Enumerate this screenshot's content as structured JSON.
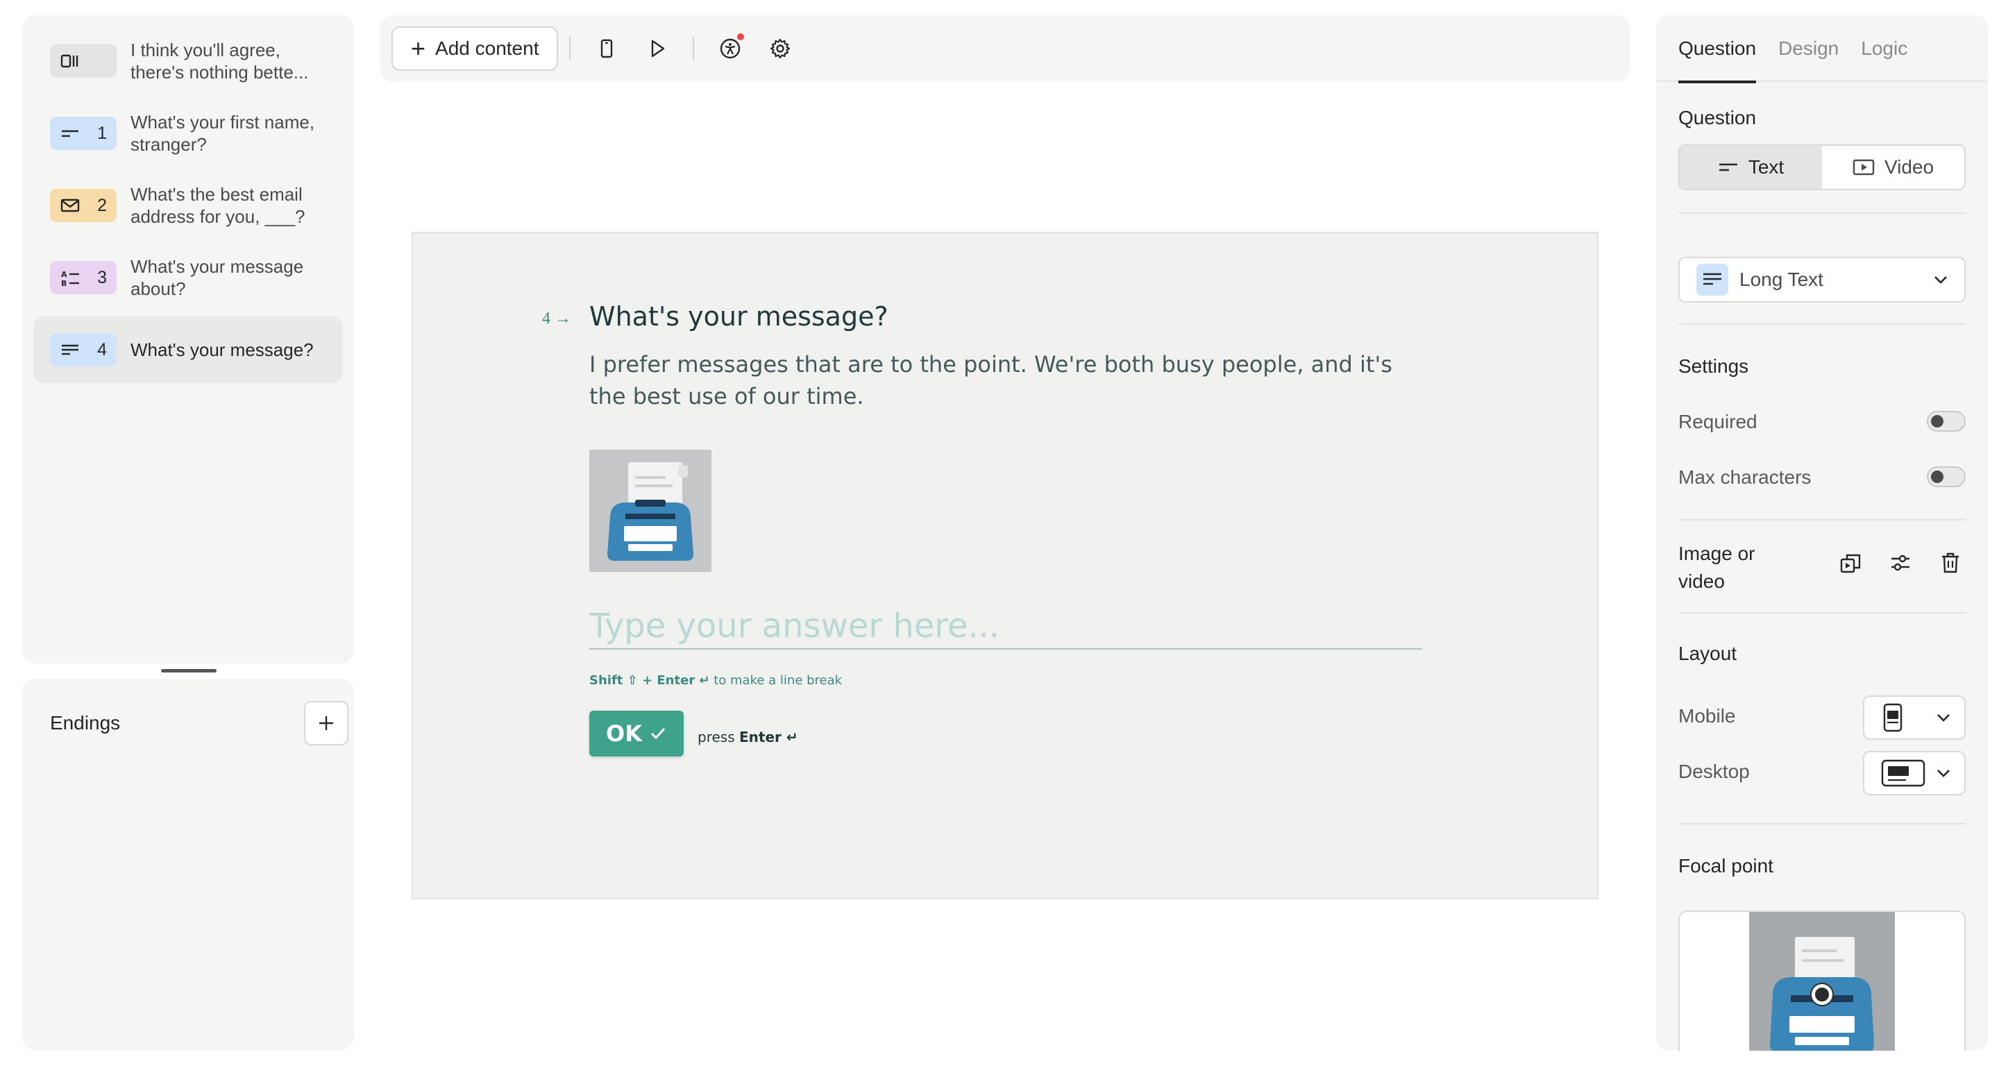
{
  "questions": [
    {
      "num": "",
      "text": "I think you'll agree, there's nothing bette...",
      "badge_color": "#e4e4e3",
      "icon": "statement-icon"
    },
    {
      "num": "1",
      "text": "What's your first name, stranger?",
      "badge_color": "#cfe4fb",
      "icon": "short-text-icon"
    },
    {
      "num": "2",
      "text": "What's the best email address for you, ___?",
      "badge_color": "#f7dcaa",
      "icon": "email-icon"
    },
    {
      "num": "3",
      "text": "What's your message about?",
      "badge_color": "#e9d3f2",
      "icon": "multiple-choice-icon"
    },
    {
      "num": "4",
      "text": "What's your message?",
      "badge_color": "#cfe4fb",
      "icon": "long-text-icon"
    }
  ],
  "endings": {
    "title": "Endings"
  },
  "toolbar": {
    "add_content_label": "Add content"
  },
  "form": {
    "question_number": "4",
    "title": "What's your message?",
    "description": "I prefer messages that are to the point. We're both busy people, and it's the best use of our time.",
    "placeholder": "Type your answer here...",
    "hint_prefix": "Shift ⇧ + Enter ↵",
    "hint_suffix": " to make a line break",
    "ok_label": "OK",
    "press_label": "press ",
    "press_key": "Enter ↵",
    "accent_color": "#3fa28a"
  },
  "right": {
    "tabs": [
      "Question",
      "Design",
      "Logic"
    ],
    "question_heading": "Question",
    "seg_text": "Text",
    "seg_video": "Video",
    "type_label": "Long Text",
    "settings_heading": "Settings",
    "required_label": "Required",
    "max_chars_label": "Max characters",
    "image_or_video_label": "Image or video",
    "layout_heading": "Layout",
    "mobile_label": "Mobile",
    "desktop_label": "Desktop",
    "focal_heading": "Focal point"
  }
}
